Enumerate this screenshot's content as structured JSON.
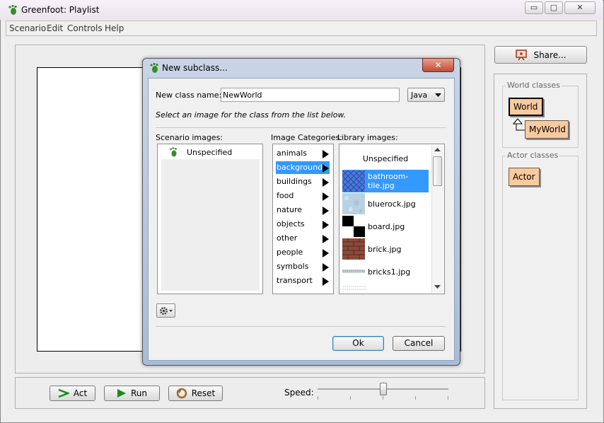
{
  "window": {
    "title": "Greenfoot: Playlist",
    "minimize": "▭",
    "maximize": "▢",
    "close": "✕"
  },
  "menu": [
    "Scenario",
    "Edit",
    "Controls",
    "Help"
  ],
  "controls": {
    "act": "Act",
    "run": "Run",
    "reset": "Reset",
    "speed_label": "Speed:",
    "speed_fraction": 0.5
  },
  "share": {
    "label": "Share..."
  },
  "classes": {
    "world_group": "World classes",
    "world": "World",
    "subclass": "MyWorld",
    "actor_group": "Actor classes",
    "actor": "Actor"
  },
  "dialog": {
    "title": "New subclass...",
    "close": "✕",
    "class_name_label": "New class name:",
    "class_name_value": "NewWorld",
    "language": "Java",
    "instruction": "Select an image for the class from the list below.",
    "scenario_images_label": "Scenario images:",
    "scenario_images": [
      "Unspecified"
    ],
    "categories_label": "Image Categories:",
    "categories": [
      "animals",
      "backgrounds",
      "buildings",
      "food",
      "nature",
      "objects",
      "other",
      "people",
      "symbols",
      "transport"
    ],
    "selected_category": "backgrounds",
    "library_label": "Library images:",
    "library_images": [
      "Unspecified",
      "bathroom-tile.jpg",
      "bluerock.jpg",
      "board.jpg",
      "brick.jpg",
      "bricks1.jpg"
    ],
    "selected_library_image": "bathroom-tile.jpg",
    "ok": "Ok",
    "cancel": "Cancel"
  },
  "colors": {
    "selection": "#3399ff",
    "class_fill": "#f8caa0",
    "dialog_frame": "#b4c6de"
  }
}
